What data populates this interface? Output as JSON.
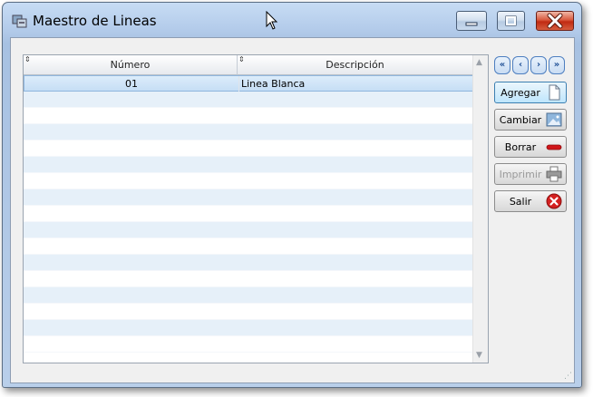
{
  "window": {
    "title": "Maestro de Lineas",
    "controls": [
      "minimize",
      "maximize",
      "close"
    ]
  },
  "grid": {
    "columns": [
      "Número",
      "Descripción"
    ],
    "rows": [
      {
        "numero": "01",
        "descripcion": "Linea Blanca"
      }
    ],
    "selected_row": 0
  },
  "navigation": {
    "buttons": [
      "first",
      "previous",
      "next",
      "last"
    ],
    "glyphs": [
      "«",
      "‹",
      "›",
      "»"
    ]
  },
  "actions": {
    "agregar": "Agregar",
    "cambiar": "Cambiar",
    "borrar": "Borrar",
    "imprimir": "Imprimir",
    "salir": "Salir"
  },
  "colors": {
    "accent": "#c6def5",
    "close": "#c12a12"
  }
}
